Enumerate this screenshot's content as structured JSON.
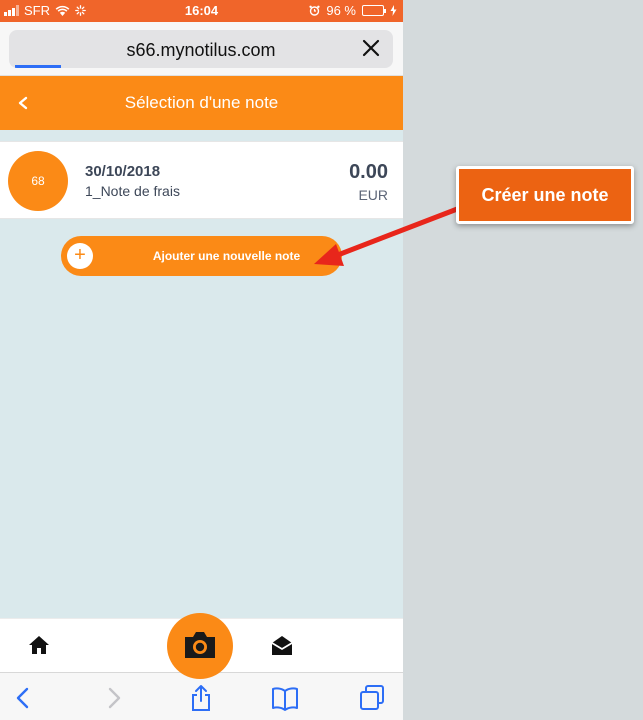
{
  "status_bar": {
    "carrier": "SFR",
    "time": "16:04",
    "battery_percent": "96 %",
    "battery_level": 0.96
  },
  "browser": {
    "url": "s66.mynotilus.com"
  },
  "header": {
    "title": "Sélection d'une note"
  },
  "note": {
    "avatar_number": "68",
    "date": "30/10/2018",
    "name": "1_Note de frais",
    "amount": "0.00",
    "currency": "EUR"
  },
  "add_button": {
    "icon": "+",
    "label": "Ajouter une nouvelle note"
  },
  "annotation": {
    "label": "Créer une note"
  },
  "colors": {
    "status_bar": "#f0652a",
    "brand_orange": "#fb8a16",
    "callout": "#ec6312",
    "arrow": "#e8261b",
    "ios_blue": "#2d6ef6"
  },
  "icons": {
    "app_bottom": [
      "home-icon",
      "camera-icon",
      "mail-open-icon"
    ],
    "safari_toolbar": [
      "back-icon",
      "forward-icon",
      "share-icon",
      "bookmarks-icon",
      "tabs-icon"
    ]
  }
}
